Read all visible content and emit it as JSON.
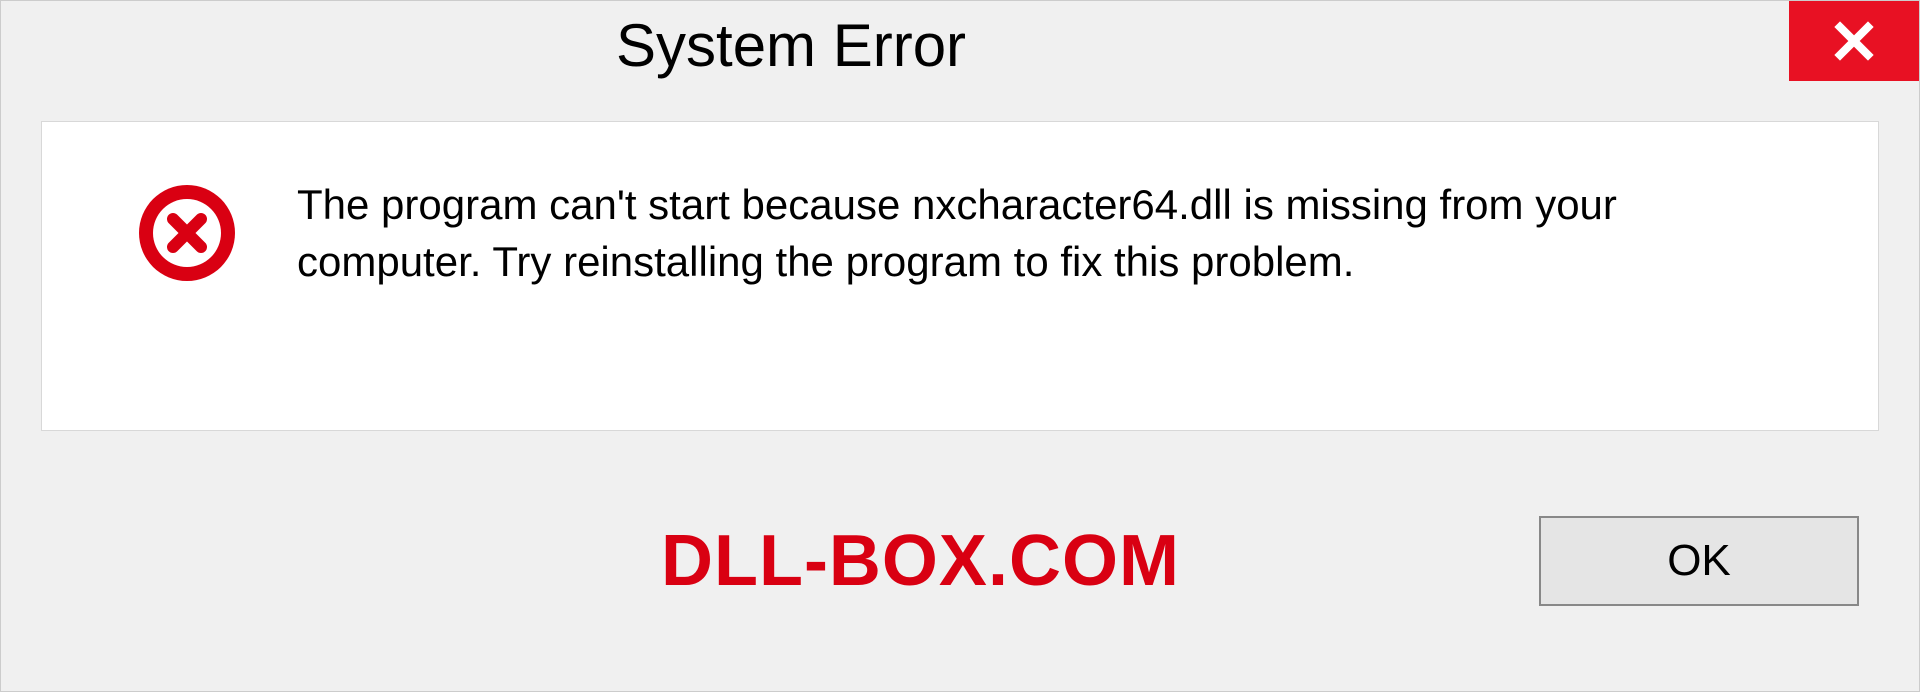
{
  "dialog": {
    "title": "System Error",
    "message": "The program can't start because nxcharacter64.dll is missing from your computer. Try reinstalling the program to fix this problem.",
    "ok_label": "OK"
  },
  "watermark": "DLL-BOX.COM"
}
